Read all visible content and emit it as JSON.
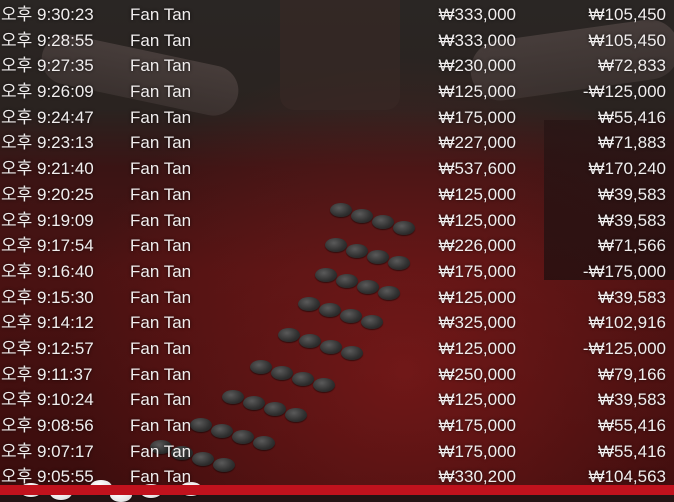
{
  "history": {
    "rows": [
      {
        "time": "오후 9:30:23",
        "game": "Fan Tan",
        "bet": "₩333,000",
        "win": "₩105,450"
      },
      {
        "time": "오후 9:28:55",
        "game": "Fan Tan",
        "bet": "₩333,000",
        "win": "₩105,450"
      },
      {
        "time": "오후 9:27:35",
        "game": "Fan Tan",
        "bet": "₩230,000",
        "win": "₩72,833"
      },
      {
        "time": "오후 9:26:09",
        "game": "Fan Tan",
        "bet": "₩125,000",
        "win": "-₩125,000"
      },
      {
        "time": "오후 9:24:47",
        "game": "Fan Tan",
        "bet": "₩175,000",
        "win": "₩55,416"
      },
      {
        "time": "오후 9:23:13",
        "game": "Fan Tan",
        "bet": "₩227,000",
        "win": "₩71,883"
      },
      {
        "time": "오후 9:21:40",
        "game": "Fan Tan",
        "bet": "₩537,600",
        "win": "₩170,240"
      },
      {
        "time": "오후 9:20:25",
        "game": "Fan Tan",
        "bet": "₩125,000",
        "win": "₩39,583"
      },
      {
        "time": "오후 9:19:09",
        "game": "Fan Tan",
        "bet": "₩125,000",
        "win": "₩39,583"
      },
      {
        "time": "오후 9:17:54",
        "game": "Fan Tan",
        "bet": "₩226,000",
        "win": "₩71,566"
      },
      {
        "time": "오후 9:16:40",
        "game": "Fan Tan",
        "bet": "₩175,000",
        "win": "-₩175,000"
      },
      {
        "time": "오후 9:15:30",
        "game": "Fan Tan",
        "bet": "₩125,000",
        "win": "₩39,583"
      },
      {
        "time": "오후 9:14:12",
        "game": "Fan Tan",
        "bet": "₩325,000",
        "win": "₩102,916"
      },
      {
        "time": "오후 9:12:57",
        "game": "Fan Tan",
        "bet": "₩125,000",
        "win": "-₩125,000"
      },
      {
        "time": "오후 9:11:37",
        "game": "Fan Tan",
        "bet": "₩250,000",
        "win": "₩79,166"
      },
      {
        "time": "오후 9:10:24",
        "game": "Fan Tan",
        "bet": "₩125,000",
        "win": "₩39,583"
      },
      {
        "time": "오후 9:08:56",
        "game": "Fan Tan",
        "bet": "₩175,000",
        "win": "₩55,416"
      },
      {
        "time": "오후 9:07:17",
        "game": "Fan Tan",
        "bet": "₩175,000",
        "win": "₩55,416"
      },
      {
        "time": "오후 9:05:55",
        "game": "Fan Tan",
        "bet": "₩330,200",
        "win": "₩104,563"
      }
    ]
  },
  "colors": {
    "text": "#f1eeee",
    "table_felt": "#4a1212",
    "accent_bar": "#c0121d"
  },
  "background": {
    "beads": "bead-icon"
  }
}
